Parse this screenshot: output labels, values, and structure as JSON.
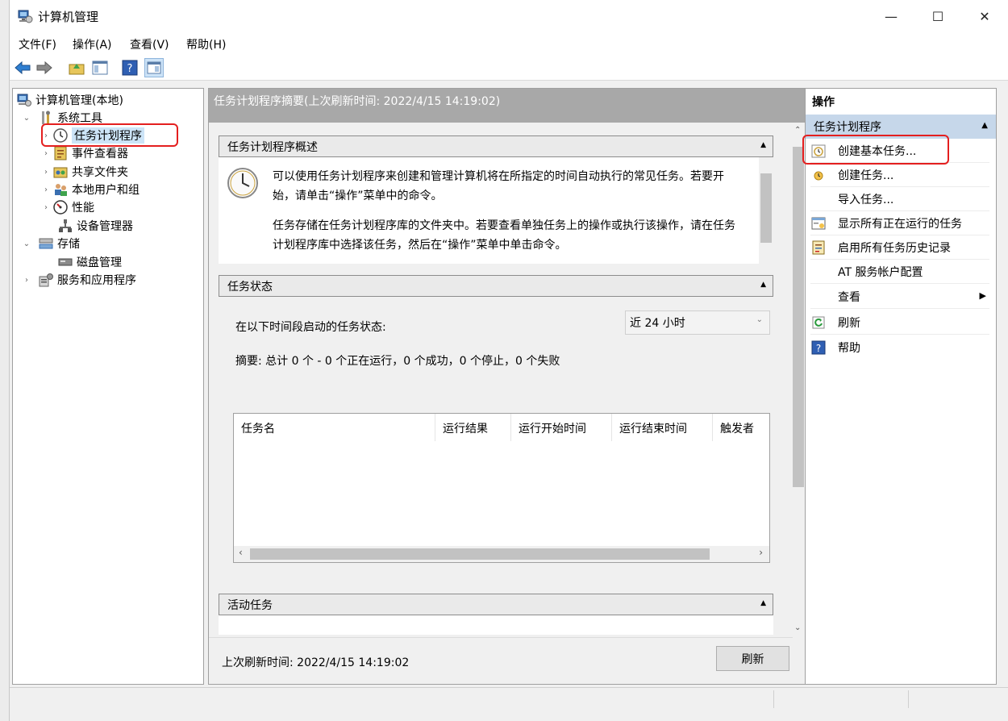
{
  "window": {
    "title": "计算机管理",
    "minimize": "—",
    "maximize": "☐",
    "close": "✕"
  },
  "menu": [
    "文件(F)",
    "操作(A)",
    "查看(V)",
    "帮助(H)"
  ],
  "tree": {
    "root": "计算机管理(本地)",
    "system_tools": "系统工具",
    "task_scheduler": "任务计划程序",
    "event_viewer": "事件查看器",
    "shared_folders": "共享文件夹",
    "local_users": "本地用户和组",
    "performance": "性能",
    "device_manager": "设备管理器",
    "storage": "存储",
    "disk_management": "磁盘管理",
    "services": "服务和应用程序"
  },
  "center": {
    "header": "任务计划程序摘要(上次刷新时间: 2022/4/15 14:19:02)",
    "overview_title": "任务计划程序概述",
    "overview_p1": "可以使用任务计划程序来创建和管理计算机将在所指定的时间自动执行的常见任务。若要开始，请单击“操作”菜单中的命令。",
    "overview_p2": "任务存储在任务计划程序库的文件夹中。若要查看单独任务上的操作或执行该操作，请在任务计划程序库中选择该任务，然后在“操作”菜单中单击命令。",
    "status_title": "任务状态",
    "status_label": "在以下时间段启动的任务状态:",
    "status_select": "近 24 小时",
    "summary": "摘要: 总计 0 个 - 0 个正在运行，0 个成功，0 个停止，0 个失败",
    "columns": [
      "任务名",
      "运行结果",
      "运行开始时间",
      "运行结束时间",
      "触发者"
    ],
    "active_title": "活动任务",
    "last_refresh": "上次刷新时间: 2022/4/15 14:19:02",
    "refresh_button": "刷新"
  },
  "actions": {
    "header": "操作",
    "group": "任务计划程序",
    "items": [
      "创建基本任务...",
      "创建任务...",
      "导入任务...",
      "显示所有正在运行的任务",
      "启用所有任务历史记录",
      "AT 服务帐户配置",
      "查看",
      "刷新",
      "帮助"
    ]
  },
  "colors": {
    "highlight": "#e41f1f",
    "group_bg": "#c6d7ea",
    "header_bg": "#a8a8a8"
  }
}
